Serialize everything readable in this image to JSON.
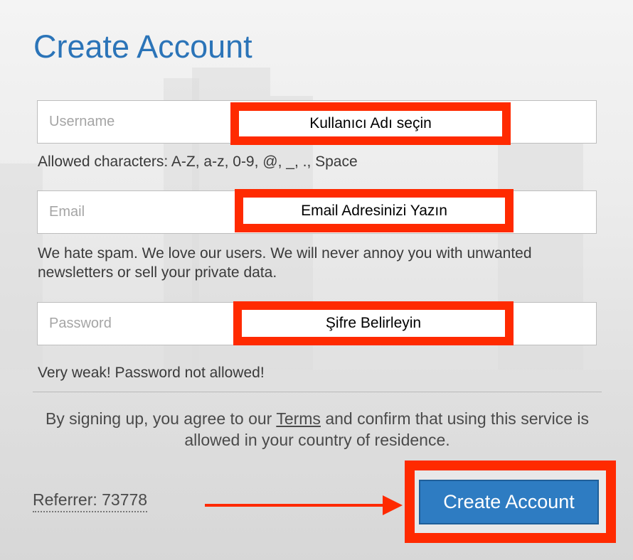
{
  "title": "Create Account",
  "form": {
    "username": {
      "placeholder": "Username",
      "annotation": "Kullanıcı Adı seçin",
      "help": "Allowed characters: A-Z, a-z, 0-9, @, _, ., Space"
    },
    "email": {
      "placeholder": "Email",
      "annotation": "Email Adresinizi Yazın",
      "help": "We hate spam. We love our users. We will never annoy you with unwanted newsletters or sell your private data."
    },
    "password": {
      "placeholder": "Password",
      "annotation": "Şifre Belirleyin",
      "help": "Very weak! Password not allowed!"
    }
  },
  "terms": {
    "before": "By signing up, you agree to our ",
    "link": "Terms",
    "after": " and confirm that using this service is allowed in your country of residence."
  },
  "referrer": "Referrer: 73778",
  "submit_label": "Create Account",
  "colors": {
    "accent": "#2e7cc2",
    "title": "#2b74b8",
    "annotation": "#ff2a00"
  }
}
